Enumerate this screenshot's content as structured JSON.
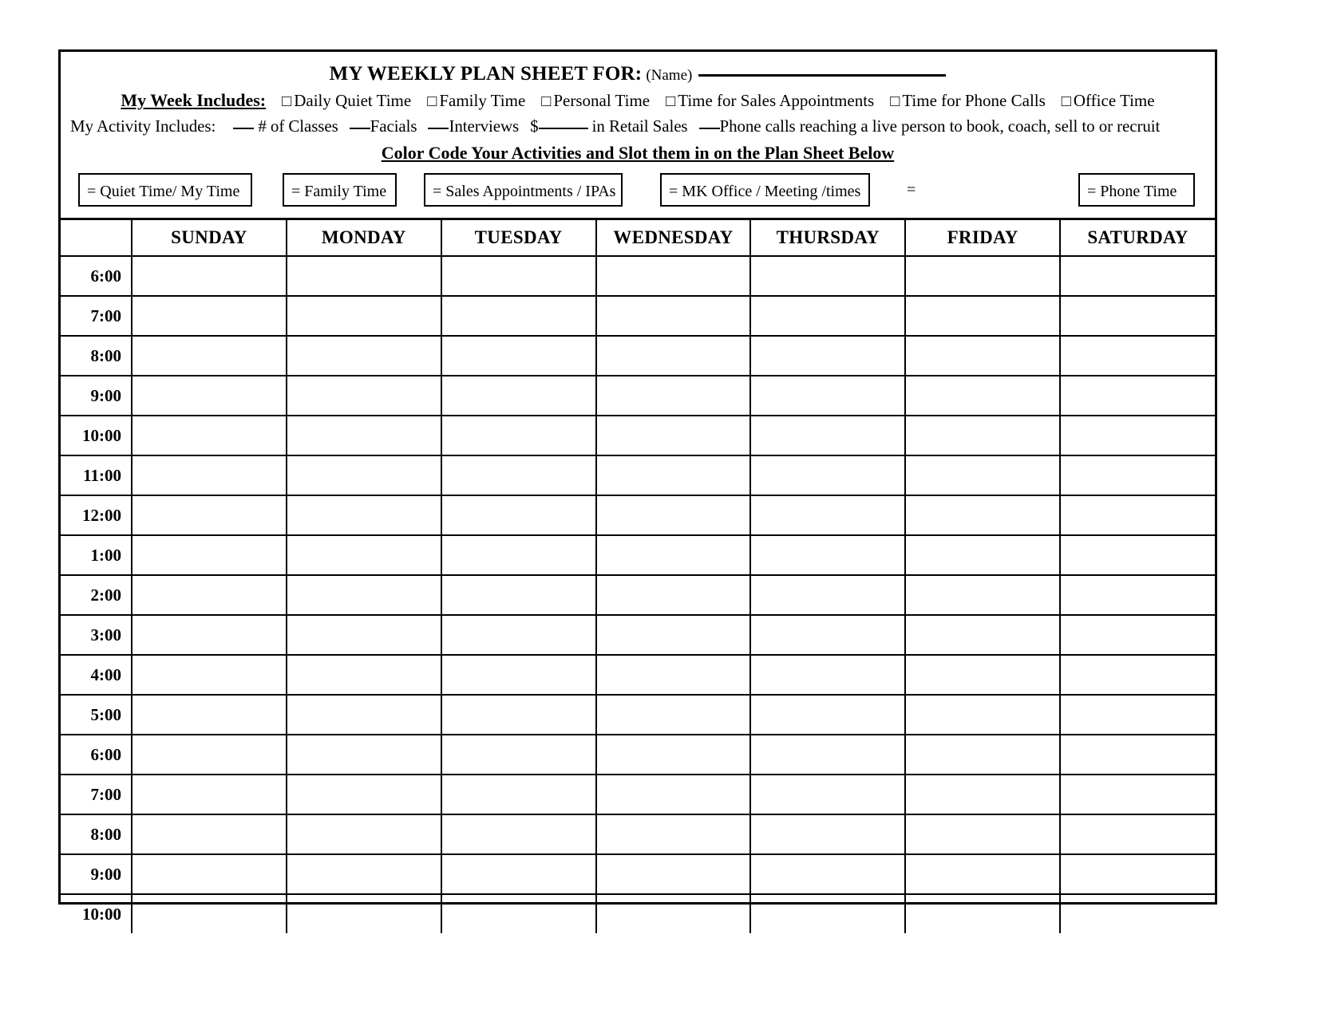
{
  "header": {
    "title": "MY WEEKLY PLAN SHEET FOR:",
    "name_hint": "(Name)",
    "week_includes_label": "My Week Includes:",
    "week_includes_items": [
      "Daily Quiet Time",
      "Family Time",
      "Personal Time",
      "Time for Sales Appointments",
      "Time for Phone Calls",
      "Office Time"
    ],
    "checkbox_glyph": "□",
    "activity_label": "My Activity Includes:",
    "activity_segments": [
      "# of Classes",
      "Facials",
      "Interviews",
      "in Retail Sales",
      "Phone calls reaching a live person to book, coach, sell to or recruit"
    ],
    "activity_currency": "$",
    "color_code_heading": "Color Code Your Activities and Slot them in on the Plan Sheet Below"
  },
  "legend": {
    "equals_glyph": "=",
    "items": [
      {
        "label": "= Quiet Time/ My Time",
        "boxed": true
      },
      {
        "label": "= Family Time",
        "boxed": true
      },
      {
        "label": "= Sales Appointments /  IPAs",
        "boxed": true
      },
      {
        "label": "= MK Office / Meeting /times",
        "boxed": true
      },
      {
        "label": "=",
        "boxed": false
      },
      {
        "label": "= Phone Time",
        "boxed": true
      }
    ]
  },
  "grid": {
    "time_column_header": "",
    "days": [
      "SUNDAY",
      "MONDAY",
      "TUESDAY",
      "WEDNESDAY",
      "THURSDAY",
      "FRIDAY",
      "SATURDAY"
    ],
    "times": [
      "6:00",
      "7:00",
      "8:00",
      "9:00",
      "10:00",
      "11:00",
      "12:00",
      "1:00",
      "2:00",
      "3:00",
      "4:00",
      "5:00",
      "6:00",
      "7:00",
      "8:00",
      "9:00",
      "10:00"
    ],
    "cells": []
  },
  "colors": {
    "ink": "#000000",
    "paper": "#ffffff"
  }
}
